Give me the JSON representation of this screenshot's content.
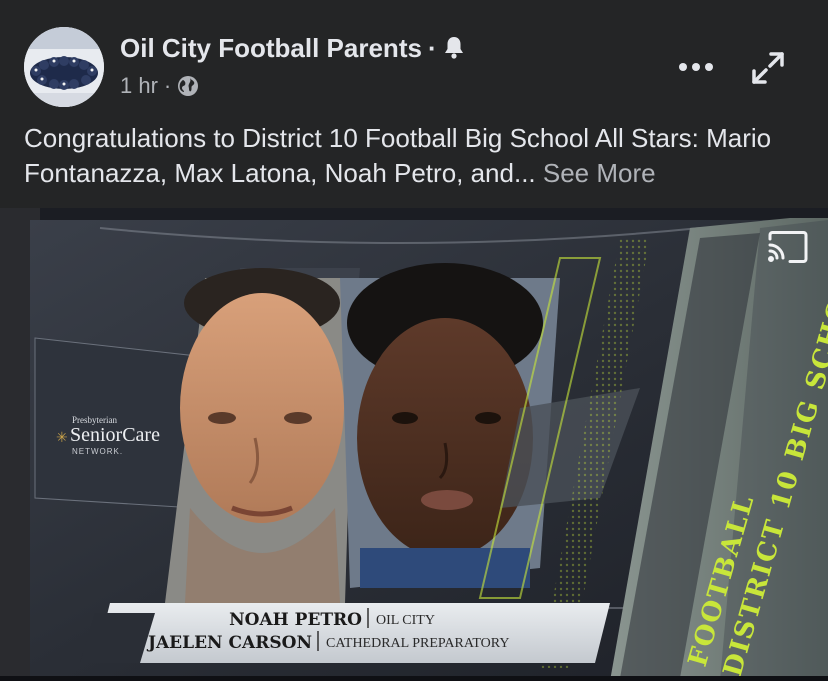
{
  "post": {
    "page_name": "Oil City Football Parents",
    "separator": "·",
    "timestamp": "1 hr",
    "meta_separator": "·",
    "caption_text": "Congratulations to District 10 Football Big School All Stars: Mario Fontanazza, Max Latona, Noah Petro, and... ",
    "see_more": "See More",
    "icons": {
      "bell": "bell-icon",
      "globe": "globe-icon",
      "more": "more-options-icon",
      "expand": "expand-icon",
      "cast": "cast-icon"
    }
  },
  "graphic": {
    "sponsor_small": "Presbyterian",
    "sponsor_main": "SeniorCare",
    "sponsor_network": "NETWORK.",
    "player1_name": "NOAH PETRO",
    "player1_school": "OIL CITY",
    "player2_name": "JAELEN CARSON",
    "player2_school": "CATHEDRAL PREPARATORY",
    "banner_line1": "FOOTBALL",
    "banner_line2": "DISTRICT 10 BIG SCHO",
    "colors": {
      "accent_green": "#c8e63a",
      "banner_text": "#1c1c1c",
      "background": "#242526"
    }
  }
}
